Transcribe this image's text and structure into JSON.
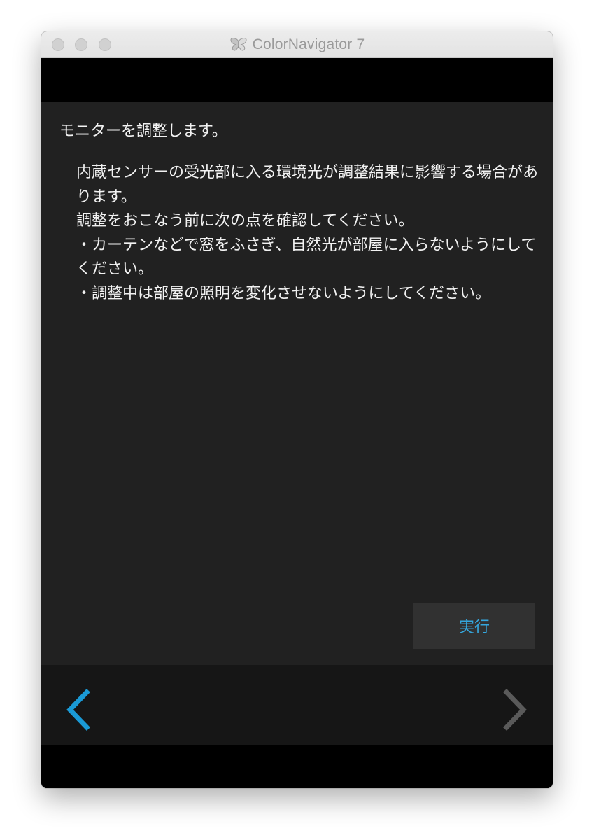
{
  "window": {
    "title": "ColorNavigator 7"
  },
  "icons": {
    "app": "butterfly-app-icon",
    "back": "chevron-left-icon",
    "next": "chevron-right-icon"
  },
  "colors": {
    "accent": "#1a9ad6",
    "content_bg": "#212121",
    "nav_bg": "#161616",
    "disabled_arrow": "#5a5a5a"
  },
  "main": {
    "heading": "モニターを調整します。",
    "paragraphs": [
      "内蔵センサーの受光部に入る環境光が調整結果に影響する場合があります。",
      "調整をおこなう前に次の点を確認してください。",
      "・カーテンなどで窓をふさぎ、自然光が部屋に入らないようにしてください。",
      "・調整中は部屋の照明を変化させないようにしてください。"
    ],
    "run_button_label": "実行"
  },
  "navigation": {
    "back_enabled": true,
    "next_enabled": false
  }
}
